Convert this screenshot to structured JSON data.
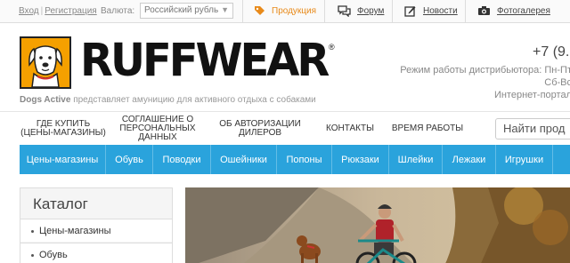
{
  "topbar": {
    "login": "Вход",
    "register": "Регистрация",
    "currency_label": "Валюта:",
    "currency_value": "Российский рубль",
    "products": "Продукция",
    "forum": "Форум",
    "news": "Новости",
    "gallery": "Фотогалерея"
  },
  "header": {
    "brand": "RUFFWEAR",
    "reg_mark": "®",
    "tagline_brand": "Dogs Active",
    "tagline_text": "представляет амуницию для активного отдыха с собаками",
    "phone": "+7 (9.",
    "hours_1": "Режим работы дистрибьютора: Пн-Пт",
    "hours_2": "Сб-Вс",
    "hours_3": "Интернет-портал"
  },
  "subnav": {
    "where_buy_1": "Где купить",
    "where_buy_2": "(цены-магазины)",
    "agreement_1": "Соглашение о",
    "agreement_2": "персональных",
    "agreement_3": "данных",
    "dealers_1": "Об авторизации",
    "dealers_2": "дилеров",
    "contacts": "Контакты",
    "work_hours": "Время работы",
    "search_placeholder": "Найти прод"
  },
  "menu": [
    "Цены-магазины",
    "Обувь",
    "Поводки",
    "Ошейники",
    "Попоны",
    "Рюкзаки",
    "Шлейки",
    "Лежаки",
    "Игрушки"
  ],
  "catalog": {
    "title": "Каталог",
    "items": [
      "Цены-магазины",
      "Обувь"
    ]
  },
  "colors": {
    "accent_blue": "#2aa3dc",
    "accent_orange": "#f5a000",
    "products_orange": "#e88a1a"
  }
}
